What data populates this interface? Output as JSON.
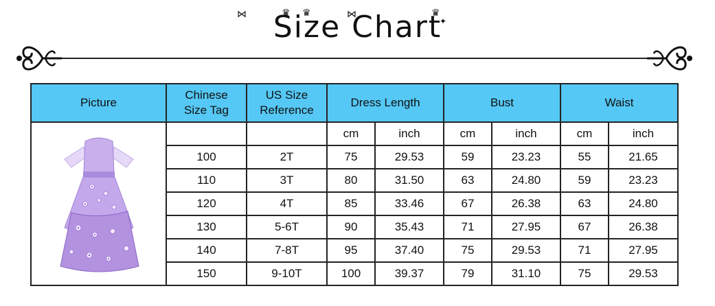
{
  "title": "Size Chart",
  "table": {
    "headers": {
      "picture": "Picture",
      "chinese_size_tag": "Chinese\nSize Tag",
      "us_size_reference": "US Size\nReference",
      "dress_length": "Dress Length",
      "bust": "Bust",
      "waist": "Waist"
    },
    "units": [
      "cm",
      "inch",
      "cm",
      "inch",
      "cm",
      "inch"
    ],
    "rows": [
      {
        "tag": "100",
        "us": "2T",
        "len_cm": "75",
        "len_in": "29.53",
        "bust_cm": "59",
        "bust_in": "23.23",
        "waist_cm": "55",
        "waist_in": "21.65"
      },
      {
        "tag": "110",
        "us": "3T",
        "len_cm": "80",
        "len_in": "31.50",
        "bust_cm": "63",
        "bust_in": "24.80",
        "waist_cm": "59",
        "waist_in": "23.23"
      },
      {
        "tag": "120",
        "us": "4T",
        "len_cm": "85",
        "len_in": "33.46",
        "bust_cm": "67",
        "bust_in": "26.38",
        "waist_cm": "63",
        "waist_in": "24.80"
      },
      {
        "tag": "130",
        "us": "5-6T",
        "len_cm": "90",
        "len_in": "35.43",
        "bust_cm": "71",
        "bust_in": "27.95",
        "waist_cm": "67",
        "waist_in": "26.38"
      },
      {
        "tag": "140",
        "us": "7-8T",
        "len_cm": "95",
        "len_in": "37.40",
        "bust_cm": "75",
        "bust_in": "29.53",
        "waist_cm": "71",
        "waist_in": "27.95"
      },
      {
        "tag": "150",
        "us": "9-10T",
        "len_cm": "100",
        "len_in": "39.37",
        "bust_cm": "79",
        "bust_in": "31.10",
        "waist_cm": "75",
        "waist_in": "29.53"
      }
    ]
  },
  "colors": {
    "header_bg": "#55c8f5",
    "dress_light": "#d9c4f0",
    "dress_mid": "#b392e0",
    "dress_dark": "#8a64c8"
  },
  "icons": [
    "scroll-ornament-left-icon",
    "scroll-ornament-right-icon",
    "bow-icon",
    "crown-icon",
    "sparkle-icon"
  ]
}
